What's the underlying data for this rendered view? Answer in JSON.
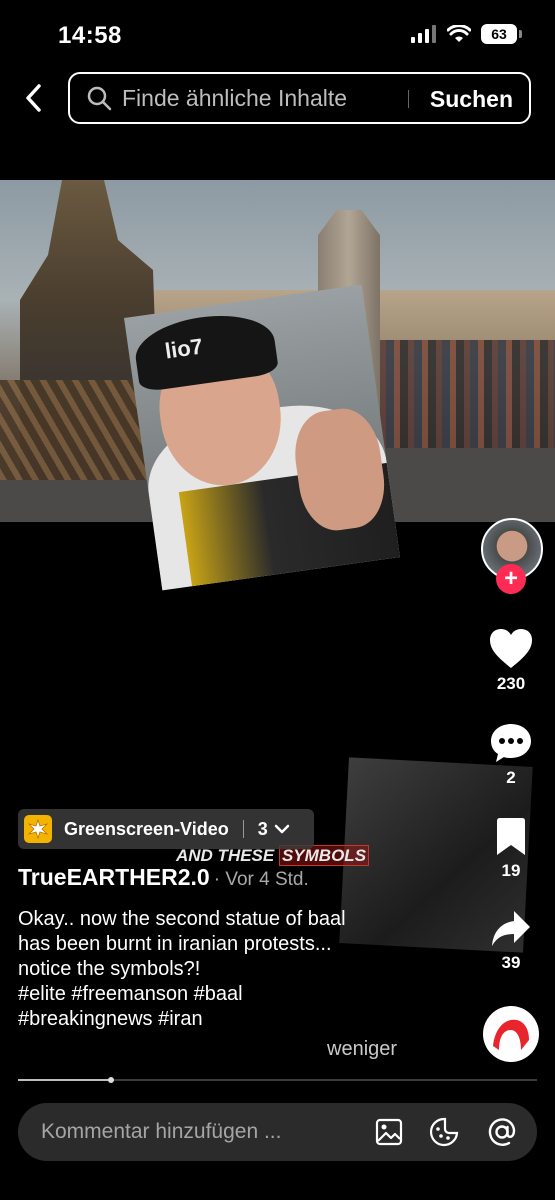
{
  "status_bar": {
    "time": "14:58",
    "battery": "63"
  },
  "header": {
    "search_placeholder": "Finde ähnliche Inhalte",
    "search_button": "Suchen"
  },
  "video": {
    "beanie_text": "lio7",
    "overlay_caption_a": "AND THESE ",
    "overlay_caption_b": "SYMBOLS"
  },
  "rail": {
    "likes": "230",
    "comments": "2",
    "bookmarks": "19",
    "shares": "39"
  },
  "post": {
    "greenscreen_label": "Greenscreen-Video",
    "greenscreen_count": "3",
    "username": "TrueEARTHER2.0",
    "posted": "· Vor 4 Std.",
    "caption_line1": "Okay.. now the second statue of baal",
    "caption_line2": "has been burnt in iranian protests...",
    "caption_line3": "notice the symbols?!",
    "caption_line4": "#elite #freemanson #baal",
    "caption_line5": "#breakingnews #iran",
    "less": "weniger",
    "progress": 0.18
  },
  "comment_bar": {
    "placeholder": "Kommentar hinzufügen ..."
  },
  "colors": {
    "accent": "#fe2c55",
    "greenscreen_icon": "#f3b400"
  }
}
